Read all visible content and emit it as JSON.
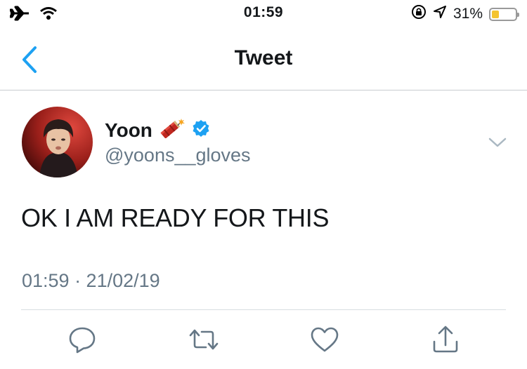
{
  "status_bar": {
    "time": "01:59",
    "battery_percent_label": "31%",
    "battery_level": 0.31,
    "battery_color": "#f4c430"
  },
  "nav": {
    "title": "Tweet",
    "accent_color": "#1da1f2"
  },
  "tweet": {
    "display_name": "Yoon",
    "name_emoji": "firecracker-emoji",
    "verified": true,
    "handle": "@yoons__gloves",
    "text": "OK I AM READY FOR THIS",
    "timestamp": "01:59 · 21/02/19"
  },
  "actions": [
    {
      "icon": "reply-icon"
    },
    {
      "icon": "retweet-icon"
    },
    {
      "icon": "like-icon"
    },
    {
      "icon": "share-icon"
    }
  ]
}
